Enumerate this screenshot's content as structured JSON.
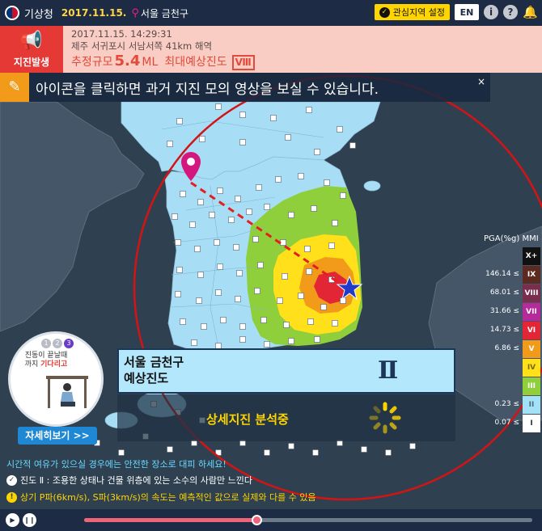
{
  "topbar": {
    "agency": "기상청",
    "date": "2017.11.15.",
    "location": "서울 금천구",
    "area_setting": "관심지역 설정",
    "lang": "EN",
    "info_icon": "info-icon",
    "alarm_icon": "bell-icon"
  },
  "banner": {
    "badge": "지진발생",
    "datetime": "2017.11.15. 14:29:31",
    "epicenter": "제주 서귀포시 서남서쪽 41km 해역",
    "mag_prefix": "추정규모",
    "magnitude": "5.4",
    "mag_unit": "ML",
    "max_label": "최대예상진도",
    "max_intensity": "Ⅷ"
  },
  "notice": {
    "text": "아이콘을 클릭하면 과거 지진 모의 영상을 보실 수 있습니다.",
    "close": "×"
  },
  "legend": {
    "header": "PGA(%g)",
    "unit": "MMI",
    "rows": [
      {
        "pga": "",
        "mmi": "X+",
        "color": "#111111",
        "fg": "#ffffff"
      },
      {
        "pga": "146.14 ≤",
        "mmi": "IX",
        "color": "#5c2a20",
        "fg": "#ffffff"
      },
      {
        "pga": "68.01 ≤",
        "mmi": "VIII",
        "color": "#7a2e4e",
        "fg": "#ffffff"
      },
      {
        "pga": "31.66 ≤",
        "mmi": "VII",
        "color": "#b62a9a",
        "fg": "#ffffff"
      },
      {
        "pga": "14.73 ≤",
        "mmi": "VI",
        "color": "#e32636",
        "fg": "#ffffff"
      },
      {
        "pga": "6.86 ≤",
        "mmi": "V",
        "color": "#f29a1a",
        "fg": "#ffffff"
      },
      {
        "pga": "",
        "mmi": "IV",
        "color": "#ffe01a",
        "fg": "#7a6a00"
      },
      {
        "pga": "",
        "mmi": "III",
        "color": "#8fcf3c",
        "fg": "#ffffff"
      },
      {
        "pga": "0.23 ≤",
        "mmi": "II",
        "color": "#a3e1f7",
        "fg": "#4a6a86"
      },
      {
        "pga": "0.07 ≤",
        "mmi": "I",
        "color": "#ffffff",
        "fg": "#333333"
      }
    ]
  },
  "location_box": {
    "name": "서울 금천구",
    "label": "예상진도",
    "intensity": "Ⅱ"
  },
  "analysis": {
    "text": "상세지진 분석중"
  },
  "guide": {
    "steps": [
      "1",
      "2",
      "3"
    ],
    "line1": "진동이 끝날때",
    "line2_a": "까지 ",
    "line2_b": "기다리고",
    "button": "자세히보기 >>"
  },
  "info": {
    "line1": "시간적 여유가 있으실 경우에는 안전한 장소로 대피 하세요!",
    "line2": "진도 Ⅱ : 조용한 상태나 건물 위층에 있는 소수의 사람만 느낀다",
    "line3": "상기 P파(6km/s), S파(3km/s)의 속도는 예측적인 값으로 실제와 다를 수 있음"
  },
  "player": {
    "progress": 0.385
  }
}
